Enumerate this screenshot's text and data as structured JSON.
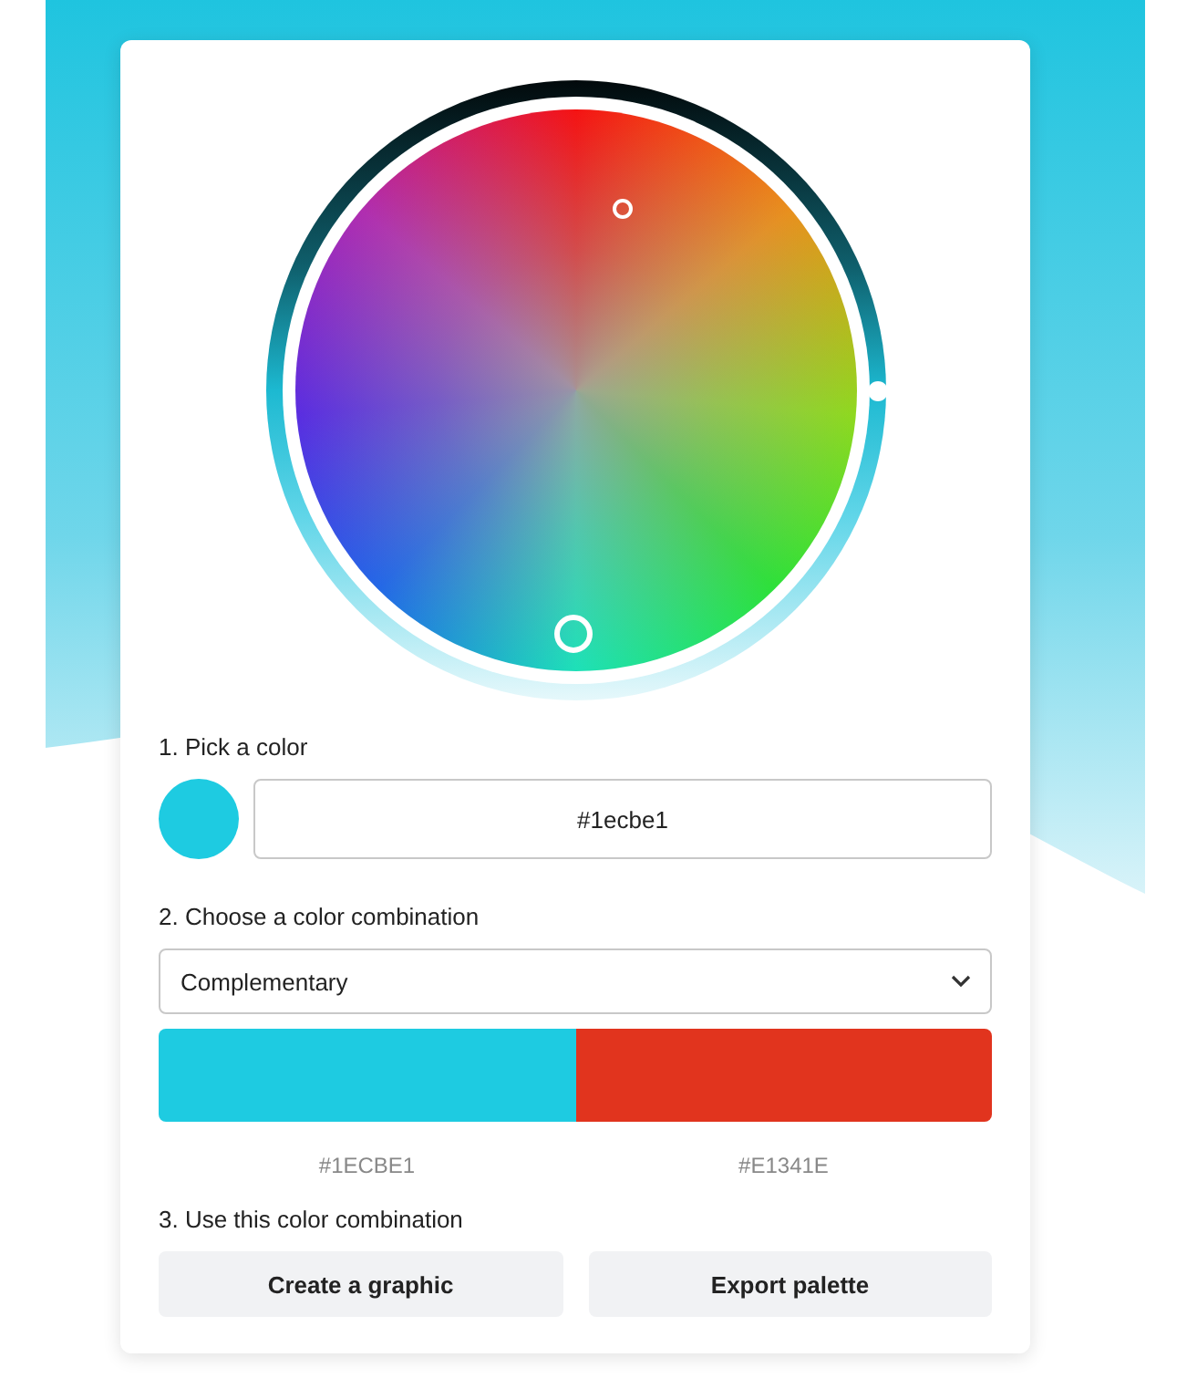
{
  "pick": {
    "label": "1. Pick a color",
    "color": "#1ecbe1",
    "value": "#1ecbe1"
  },
  "combination": {
    "label": "2. Choose a color combination",
    "value": "Complementary",
    "swatches": [
      {
        "color": "#1ecbe1",
        "label": "#1ECBE1"
      },
      {
        "color": "#e1341e",
        "label": "#E1341E"
      }
    ]
  },
  "use": {
    "label": "3. Use this color combination",
    "buttons": [
      "Create a graphic",
      "Export palette"
    ]
  }
}
